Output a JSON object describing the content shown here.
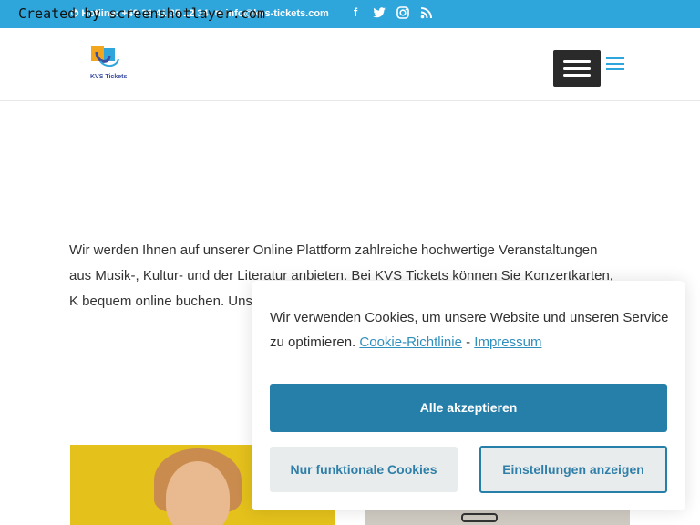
{
  "watermark": "Created by screenshotlayer.com",
  "topbar": {
    "phone": "Hotline: +49 36 41 35 12 34",
    "email": "info@kvs-tickets.com",
    "social_icons": [
      "facebook-icon",
      "twitter-icon",
      "instagram-icon",
      "rss-icon"
    ]
  },
  "header": {
    "logo_text": "KVS Tickets"
  },
  "intro": {
    "text": "Wir werden Ihnen auf unserer Online Plattform zahlreiche hochwertige Veranstaltungen aus Musik-, Kultur- und der Literatur anbieten. Bei KVS Tickets können Sie Konzertkarten, K bequem online buchen. Uns Bereichen des kulturellen Le durch die Corona Krise nahe"
  },
  "cookie": {
    "message": "Wir verwenden Cookies, um unsere Website und unseren Service zu optimieren.",
    "policy_link": "Cookie-Richtlinie",
    "separator": "-",
    "imprint_link": "Impressum",
    "accept_all": "Alle akzeptieren",
    "functional_only": "Nur funktionale Cookies",
    "show_settings": "Einstellungen anzeigen"
  },
  "colors": {
    "topbar": "#2fa6db",
    "accent": "#267fa9",
    "link": "#2f8fbd"
  }
}
